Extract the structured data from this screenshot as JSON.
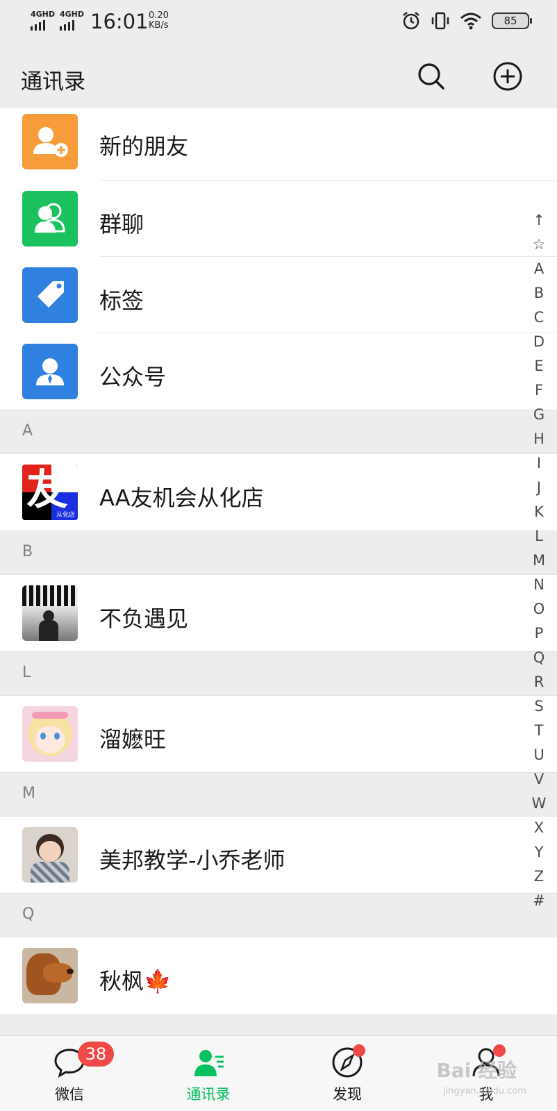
{
  "status_bar": {
    "signal_1": "4GHD",
    "signal_2": "4GHD",
    "time": "16:01",
    "speed_value": "0.20",
    "speed_unit": "KB/s",
    "battery": "85",
    "icons": [
      "alarm-icon",
      "vibrate-icon",
      "wifi-icon",
      "battery-icon"
    ]
  },
  "header": {
    "title": "通讯录",
    "actions": [
      "search-icon",
      "plus-circle-icon"
    ]
  },
  "shortcuts": [
    {
      "label": "新的朋友",
      "icon": "add-friend-icon",
      "color": "#f79c3a"
    },
    {
      "label": "群聊",
      "icon": "group-chat-icon",
      "color": "#1bc15e"
    },
    {
      "label": "标签",
      "icon": "tag-icon",
      "color": "#2f80df"
    },
    {
      "label": "公众号",
      "icon": "official-account-icon",
      "color": "#2f80df"
    }
  ],
  "sections": [
    {
      "letter": "A",
      "contacts": [
        {
          "name": "AA友机会从化店",
          "avatar_text": "友",
          "avatar_caption": "从化店"
        }
      ]
    },
    {
      "letter": "B",
      "contacts": [
        {
          "name": "不负遇见"
        }
      ]
    },
    {
      "letter": "L",
      "contacts": [
        {
          "name": "溜嬷旺"
        }
      ]
    },
    {
      "letter": "M",
      "contacts": [
        {
          "name": "美邦教学-小乔老师"
        }
      ]
    },
    {
      "letter": "Q",
      "contacts": [
        {
          "name": "秋枫🍁"
        }
      ]
    }
  ],
  "index_bar": [
    "↑",
    "☆",
    "A",
    "B",
    "C",
    "D",
    "E",
    "F",
    "G",
    "H",
    "I",
    "J",
    "K",
    "L",
    "M",
    "N",
    "O",
    "P",
    "Q",
    "R",
    "S",
    "T",
    "U",
    "V",
    "W",
    "X",
    "Y",
    "Z",
    "#"
  ],
  "tabs": [
    {
      "label": "微信",
      "icon": "chat-icon",
      "badge": "38"
    },
    {
      "label": "通讯录",
      "icon": "contacts-icon",
      "active": true
    },
    {
      "label": "发现",
      "icon": "compass-icon",
      "dot": true
    },
    {
      "label": "我",
      "icon": "person-icon",
      "dot": true
    }
  ],
  "colors": {
    "accent": "#07c160",
    "badge": "#f04a47",
    "background": "#ededed"
  },
  "watermark": {
    "text": "Bai 经验",
    "sub": "jingyan.baidu.com"
  }
}
